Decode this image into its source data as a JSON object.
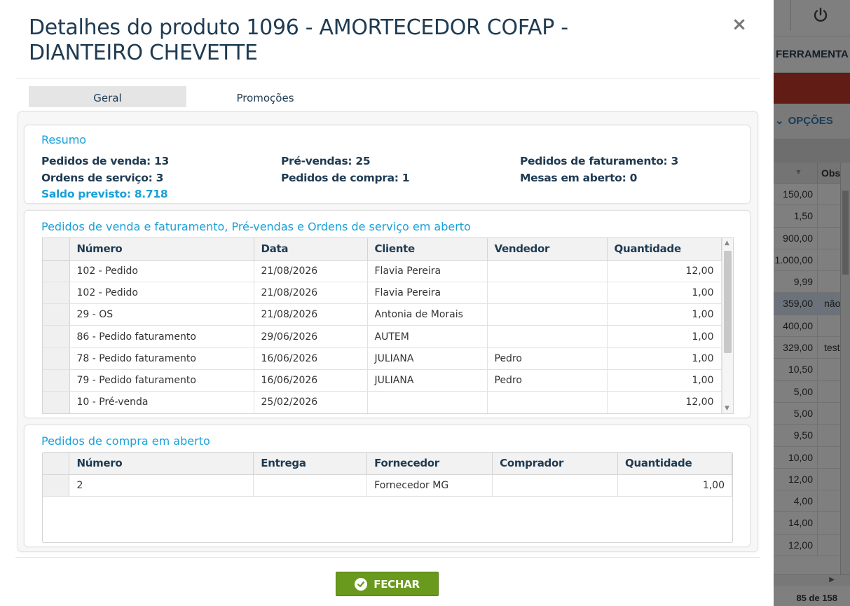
{
  "modal": {
    "title": "Detalhes do produto 1096 - AMORTECEDOR COFAP - DIANTEIRO CHEVETTE",
    "tabs": [
      {
        "label": "Geral",
        "active": true
      },
      {
        "label": "Promoções",
        "active": false
      }
    ],
    "resumo": {
      "title": "Resumo",
      "pedidos_venda": "Pedidos de venda: 13",
      "pre_vendas": "Pré-vendas: 25",
      "pedidos_faturamento": "Pedidos de faturamento: 3",
      "ordens_servico": "Ordens de serviço: 3",
      "pedidos_compra": "Pedidos de compra: 1",
      "mesas_aberto": "Mesas em aberto: 0",
      "saldo_previsto": "Saldo previsto: 8.718"
    },
    "abertos": {
      "title": "Pedidos de venda e faturamento, Pré-vendas e Ordens de serviço em aberto",
      "columns": [
        "Número",
        "Data",
        "Cliente",
        "Vendedor",
        "Quantidade"
      ],
      "rows": [
        [
          "102 - Pedido",
          "21/08/2026",
          "Flavia Pereira",
          "",
          "12,00"
        ],
        [
          "102 - Pedido",
          "21/08/2026",
          "Flavia Pereira",
          "",
          "1,00"
        ],
        [
          "29 - OS",
          "21/08/2026",
          "Antonia de Morais",
          "",
          "1,00"
        ],
        [
          "86 - Pedido faturamento",
          "29/06/2026",
          "AUTEM",
          "",
          "1,00"
        ],
        [
          "78 - Pedido faturamento",
          "16/06/2026",
          "JULIANA",
          "Pedro",
          "1,00"
        ],
        [
          "79 - Pedido faturamento",
          "16/06/2026",
          "JULIANA",
          "Pedro",
          "1,00"
        ],
        [
          "10 - Pré-venda",
          "25/02/2026",
          "",
          "",
          "12,00"
        ]
      ]
    },
    "compra": {
      "title": "Pedidos de compra em aberto",
      "columns": [
        "Número",
        "Entrega",
        "Fornecedor",
        "Comprador",
        "Quantidade"
      ],
      "rows": [
        [
          "2",
          "",
          "Fornecedor MG",
          "",
          "1,00"
        ]
      ]
    },
    "close_button": "FECHAR"
  },
  "background": {
    "menu_fragment": "FERRAMENTA",
    "options_label": "OPÇÕES",
    "obs_header": "Obs",
    "values": [
      "150,00",
      "1,50",
      "900,00",
      "1.000,00",
      "9,99",
      "359,00",
      "400,00",
      "329,00",
      "10,50",
      "5,00",
      "5,00",
      "9,50",
      "10,00",
      "12,00",
      "4,00",
      "14,00",
      "12,00"
    ],
    "obs_values": [
      "",
      "",
      "",
      "",
      "",
      "não",
      "",
      "test",
      "",
      "",
      "",
      "",
      "",
      "",
      "",
      "",
      ""
    ],
    "footer_count": "85 de 158"
  },
  "colors": {
    "accent": "#1aa0d8",
    "title": "#1f3b52",
    "button_green": "#6a9a1d",
    "red_bar": "#c0392b"
  }
}
